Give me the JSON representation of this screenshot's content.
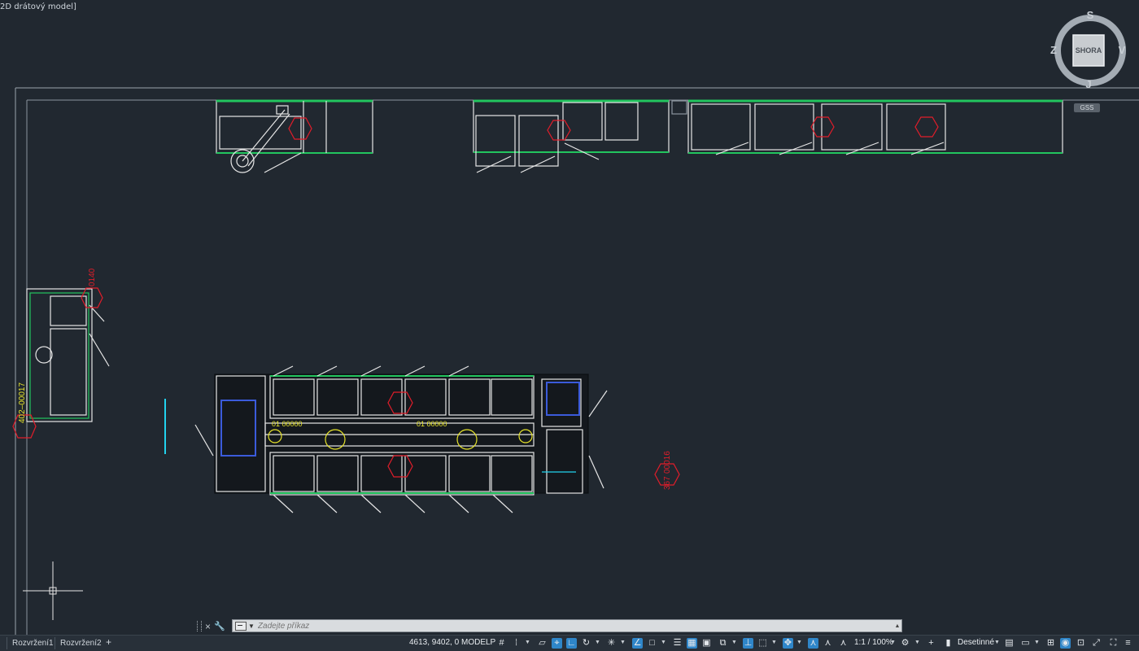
{
  "viewport": {
    "view_label": "2D drátový model]",
    "viewcube": {
      "face": "SHORA",
      "north": "S",
      "south": "J",
      "east": "V",
      "west": "Z"
    },
    "wcs_menu": "GSS",
    "labels": {
      "tag_left_top": "0140",
      "tag_left_bottom": "402–00017",
      "tag_right": "00016",
      "tag_right_prefix": "367",
      "text_conveyor_1": "01 00000",
      "text_conveyor_2": "01 00000"
    }
  },
  "command_line": {
    "placeholder": "Zadejte příkaz",
    "close_label": "×",
    "customize_icon": "wrench-icon"
  },
  "statusbar": {
    "layout_tabs": [
      "Rozvržení1",
      "Rozvržení2"
    ],
    "add_tab_label": "+",
    "coordinates": "4613, 9402, 0",
    "space": "MODELP",
    "annotation_scale": "1:1 / 100%",
    "units": "Desetinné"
  },
  "colors": {
    "background": "#212830",
    "geometry_white": "#e6e6e6",
    "geometry_green": "#22c55e",
    "tag_red": "#e11d2a",
    "text_yellow": "#e6e32a",
    "accent_blue": "#2f86c9",
    "cyan": "#22d3ee"
  }
}
